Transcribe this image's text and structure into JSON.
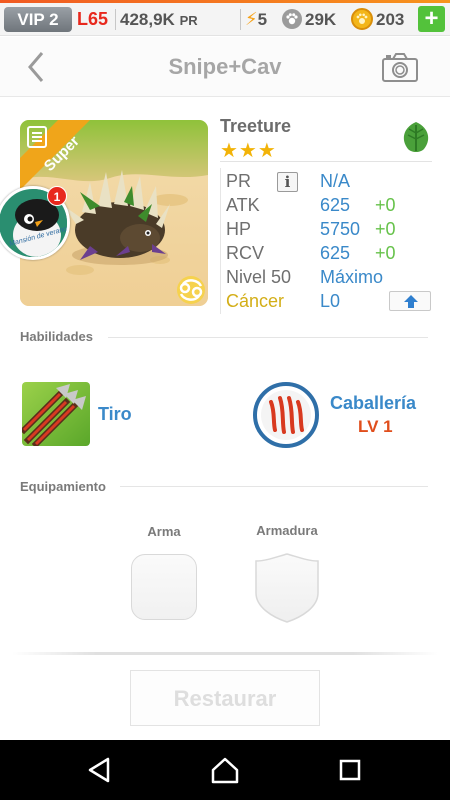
{
  "status": {
    "vip": "VIP 2",
    "level": "L65",
    "pr_value": "428,9K",
    "pr_unit": "PR",
    "energy": "5",
    "paws": "29K",
    "coins": "203",
    "plus": "+"
  },
  "header": {
    "title": "Snipe+Cav"
  },
  "creature": {
    "rarity": "Super",
    "name": "Treeture",
    "stars": "★★★",
    "star_count": 3,
    "notification_count": "1",
    "avatar_text": "Mansión de verano!",
    "stats": [
      {
        "label": "PR",
        "value": "N/A",
        "bonus": ""
      },
      {
        "label": "ATK",
        "value": "625",
        "bonus": "+0"
      },
      {
        "label": "HP",
        "value": "5750",
        "bonus": "+0"
      },
      {
        "label": "RCV",
        "value": "625",
        "bonus": "+0"
      },
      {
        "label": "Nivel 50",
        "value": "Máximo",
        "bonus": ""
      },
      {
        "label": "Cáncer",
        "value": "L0",
        "bonus": ""
      }
    ]
  },
  "skills": {
    "title": "Habilidades",
    "items": [
      {
        "name": "Tiro",
        "level": ""
      },
      {
        "name": "Caballería",
        "level": "LV 1"
      }
    ]
  },
  "equipment": {
    "title": "Equipamiento",
    "weapon_label": "Arma",
    "armor_label": "Armadura"
  },
  "actions": {
    "restore": "Restaurar"
  },
  "colors": {
    "accent_blue": "#3a89c9",
    "bonus_green": "#66c24a",
    "star_gold": "#f2b308",
    "level_red": "#e8281d",
    "skill_level_orange": "#e04e1c",
    "zodiac_gold": "#d3ae17"
  },
  "icons": {
    "back": "chevron-left-icon",
    "camera": "camera-icon",
    "element": "leaf-icon",
    "info": "info-icon",
    "upgrade": "arrow-up-icon",
    "zodiac": "cancer-icon",
    "energy": "bolt-icon",
    "paw": "paw-icon",
    "coin": "coin-icon"
  }
}
